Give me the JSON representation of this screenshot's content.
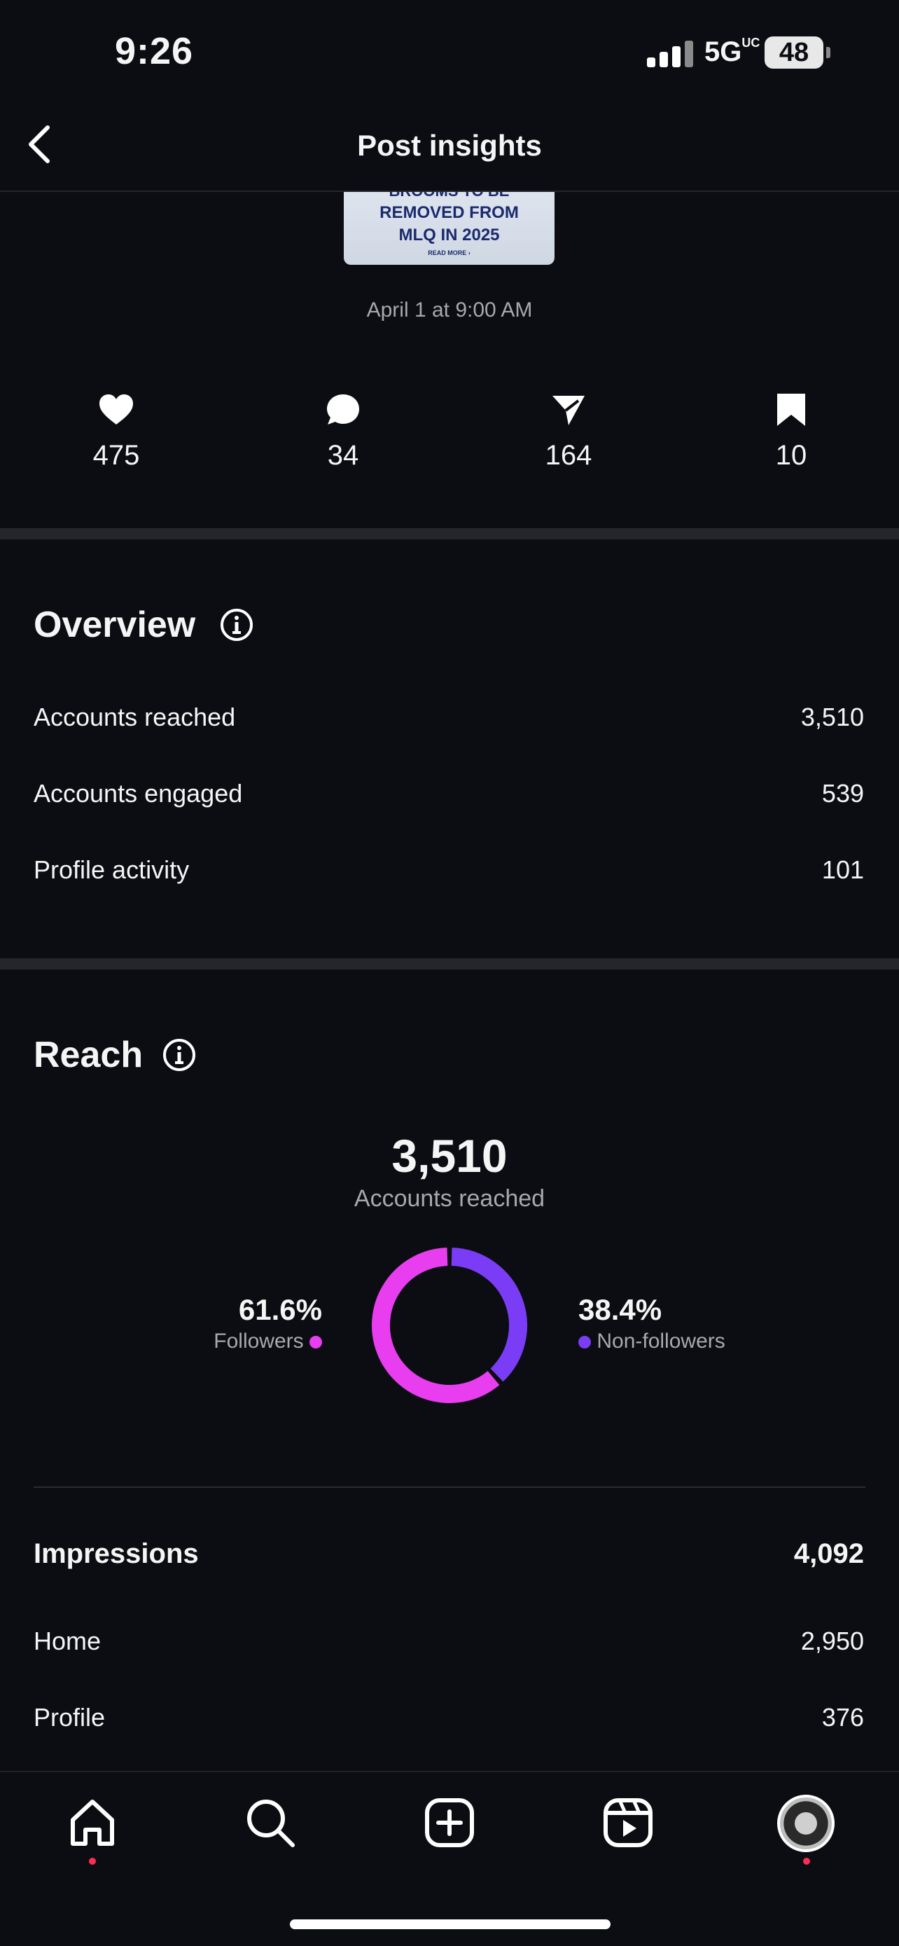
{
  "status_bar": {
    "time": "9:26",
    "network": "5G",
    "network_suffix": "UC",
    "battery": "48"
  },
  "header": {
    "title": "Post insights",
    "back_icon": "chevron-left-icon"
  },
  "post": {
    "thumbnail_lines": [
      "BROOMS TO BE",
      "REMOVED FROM",
      "MLQ IN 2025",
      "READ MORE ›"
    ],
    "date": "April 1 at 9:00 AM"
  },
  "engagement": [
    {
      "icon": "heart-icon",
      "value": "475"
    },
    {
      "icon": "comment-icon",
      "value": "34"
    },
    {
      "icon": "share-icon",
      "value": "164"
    },
    {
      "icon": "bookmark-icon",
      "value": "10"
    }
  ],
  "overview": {
    "title": "Overview",
    "rows": [
      {
        "label": "Accounts reached",
        "value": "3,510"
      },
      {
        "label": "Accounts engaged",
        "value": "539"
      },
      {
        "label": "Profile activity",
        "value": "101"
      }
    ]
  },
  "reach": {
    "title": "Reach",
    "total": "3,510",
    "total_label": "Accounts reached",
    "followers_pct": "61.6%",
    "followers_label": "Followers",
    "non_followers_pct": "38.4%",
    "non_followers_label": "Non-followers",
    "followers_fraction": 0.616,
    "followers_color": "#e83ef0",
    "non_followers_color": "#7a3cf5"
  },
  "impressions": {
    "label": "Impressions",
    "value": "4,092",
    "rows": [
      {
        "label": "Home",
        "value": "2,950"
      },
      {
        "label": "Profile",
        "value": "376"
      }
    ]
  },
  "bottom_nav": [
    "home-icon",
    "search-icon",
    "create-icon",
    "reels-icon",
    "profile-avatar"
  ],
  "colors": {
    "background": "#0b0d12",
    "notification_dot": "#ff2d55"
  }
}
